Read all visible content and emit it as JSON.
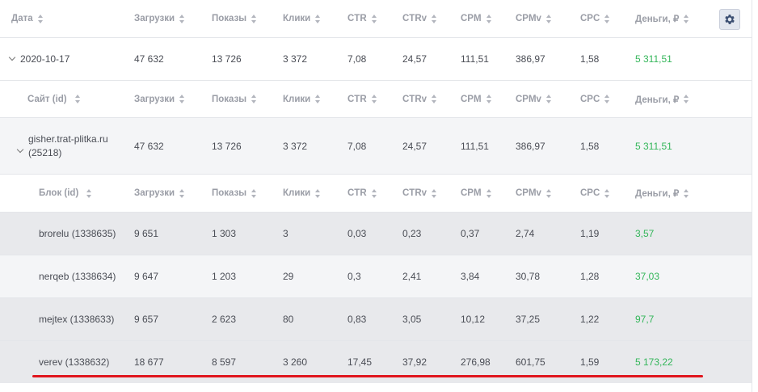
{
  "top_header": [
    "Дата",
    "Загрузки",
    "Показы",
    "Клики",
    "CTR",
    "CTRv",
    "CPM",
    "CPMv",
    "CPC",
    "Деньги, ₽"
  ],
  "date_row": [
    "2020-10-17",
    "47 632",
    "13 726",
    "3 372",
    "7,08",
    "24,57",
    "111,51",
    "386,97",
    "1,58",
    "5 311,51"
  ],
  "site_header": [
    "Сайт (id)",
    "Загрузки",
    "Показы",
    "Клики",
    "CTR",
    "CTRv",
    "CPM",
    "CPMv",
    "CPC",
    "Деньги, ₽"
  ],
  "site_row": {
    "site_line1": "gisher.trat-plitka.ru",
    "site_line2": "(25218)",
    "values": [
      "47 632",
      "13 726",
      "3 372",
      "7,08",
      "24,57",
      "111,51",
      "386,97",
      "1,58",
      "5 311,51"
    ]
  },
  "block_header": [
    "Блок (id)",
    "Загрузки",
    "Показы",
    "Клики",
    "CTR",
    "CTRv",
    "CPM",
    "CPMv",
    "CPC",
    "Деньги, ₽"
  ],
  "block_rows": [
    [
      "brorelu (1338635)",
      "9 651",
      "1 303",
      "3",
      "0,03",
      "0,23",
      "0,37",
      "2,74",
      "1,19",
      "3,57"
    ],
    [
      "nerqeb (1338634)",
      "9 647",
      "1 203",
      "29",
      "0,3",
      "2,41",
      "3,84",
      "30,78",
      "1,28",
      "37,03"
    ],
    [
      "mejtex (1338633)",
      "9 657",
      "2 623",
      "80",
      "0,83",
      "3,05",
      "10,12",
      "37,25",
      "1,22",
      "97,7"
    ],
    [
      "verev (1338632)",
      "18 677",
      "8 597",
      "3 260",
      "17,45",
      "37,92",
      "276,98",
      "601,75",
      "1,59",
      "5 173,22"
    ]
  ],
  "settings_icon": "gear-icon",
  "colors": {
    "money": "#34b65a",
    "highlight_underline": "#e0161d",
    "settings_bg": "#e3e7ef"
  }
}
